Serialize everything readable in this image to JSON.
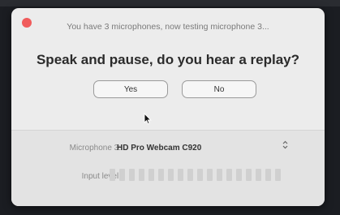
{
  "dialog": {
    "subtitle": "You have 3 microphones, now testing microphone 3...",
    "question": "Speak and pause, do you hear a replay?",
    "yes_label": "Yes",
    "no_label": "No",
    "microphone_label": "Microphone 3:",
    "microphone_value": "HD Pro Webcam C920",
    "input_level_label": "Input level:",
    "input_level_fraction": 0
  },
  "colors": {
    "close": "#f05b5b",
    "dialog_bg": "#ececec",
    "backdrop": "#1b1d22"
  },
  "icons": {
    "close": "close-dot-icon",
    "cursor": "pointer-cursor-icon",
    "select": "select-chevron-icon"
  }
}
